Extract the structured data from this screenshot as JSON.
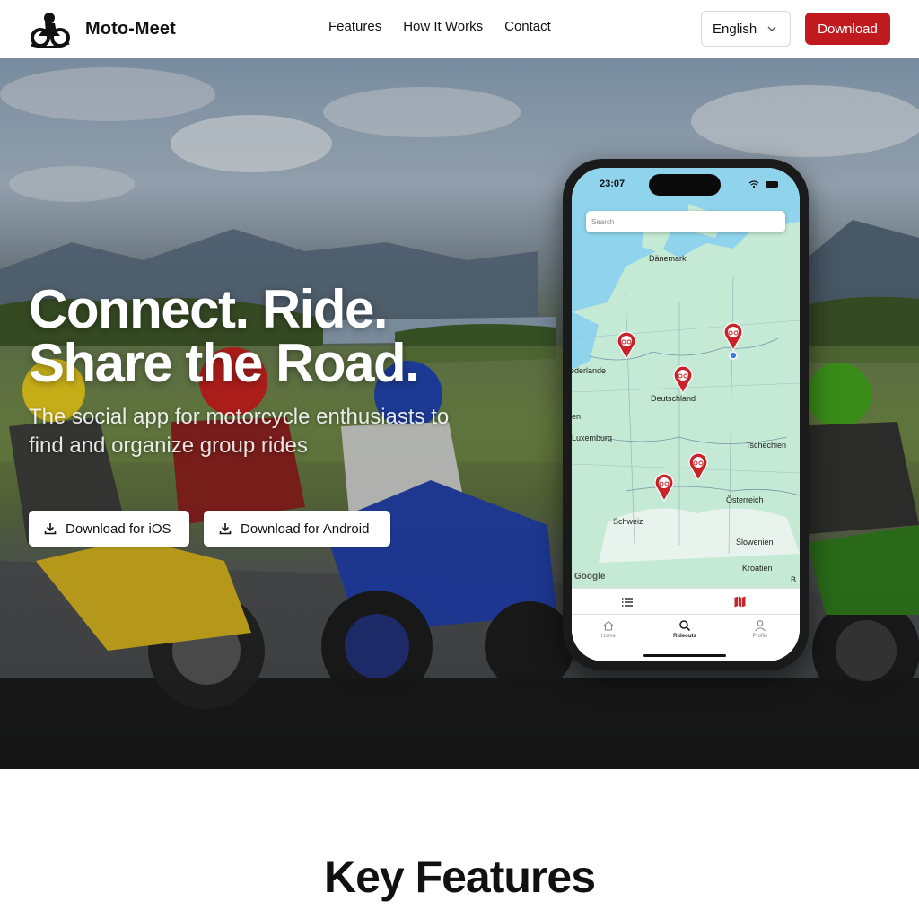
{
  "nav": {
    "brand_name": "Moto-Meet",
    "links": [
      "Features",
      "How It Works",
      "Contact"
    ],
    "language": "English",
    "download_label": "Download"
  },
  "hero": {
    "title_line1": "Connect. Ride.",
    "title_line2": "Share the Road.",
    "subtitle": "The social app for motorcycle enthusiasts to find and organize group rides",
    "ios_button": "Download for iOS",
    "android_button": "Download for Android"
  },
  "phone": {
    "time": "23:07",
    "search_placeholder": "Search",
    "map_labels": [
      "Dänemark",
      "ederlande",
      "Deutschland",
      "en",
      "Luxemburg",
      "Tschechien",
      "Österreich",
      "Schweiz",
      "Slowenien",
      "Kroatien",
      "B"
    ],
    "map_attribution": "Google",
    "tabs": [
      "Home",
      "Rideouts",
      "Profile"
    ],
    "active_tab": "Rideouts"
  },
  "features": {
    "title": "Key Features"
  },
  "colors": {
    "accent": "#c0191e",
    "map_water": "#8fd4ec",
    "map_land": "#bfe7d2"
  },
  "icons": {
    "brand": "motorcycle-logo",
    "chevron": "chevron-down-icon",
    "download": "download-icon",
    "pin": "map-pin-icon",
    "list": "list-icon",
    "map": "map-icon",
    "home": "home-icon",
    "search": "search-icon",
    "profile": "profile-icon"
  }
}
